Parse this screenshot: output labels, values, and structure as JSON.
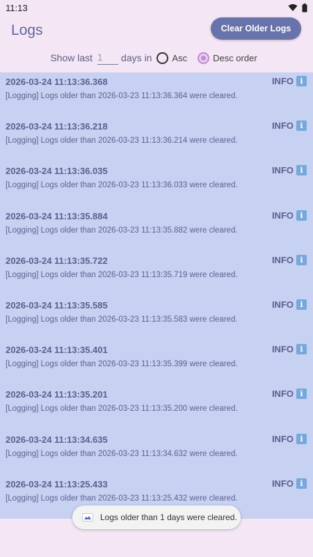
{
  "status_bar": {
    "time": "11:13",
    "icons": [
      "wifi-icon",
      "battery-icon"
    ]
  },
  "header": {
    "title": "Logs",
    "clear_button_label": "Clear Older Logs"
  },
  "filter": {
    "show_last_label": "Show last",
    "days_value": "1",
    "days_in_label": "days in",
    "asc_label": "Asc",
    "desc_label": "Desc order",
    "selected_order": "desc"
  },
  "logs": [
    {
      "time": "2026-03-24 11:13:36.368",
      "level": "INFO",
      "message": "[Logging] Logs older than 2026-03-23 11:13:36.364 were cleared."
    },
    {
      "time": "2026-03-24 11:13:36.218",
      "level": "INFO",
      "message": "[Logging] Logs older than 2026-03-23 11:13:36.214 were cleared."
    },
    {
      "time": "2026-03-24 11:13:36.035",
      "level": "INFO",
      "message": "[Logging] Logs older than 2026-03-23 11:13:36.033 were cleared."
    },
    {
      "time": "2026-03-24 11:13:35.884",
      "level": "INFO",
      "message": "[Logging] Logs older than 2026-03-23 11:13:35.882 were cleared."
    },
    {
      "time": "2026-03-24 11:13:35.722",
      "level": "INFO",
      "message": "[Logging] Logs older than 2026-03-23 11:13:35.719 were cleared."
    },
    {
      "time": "2026-03-24 11:13:35.585",
      "level": "INFO",
      "message": "[Logging] Logs older than 2026-03-23 11:13:35.583 were cleared."
    },
    {
      "time": "2026-03-24 11:13:35.401",
      "level": "INFO",
      "message": "[Logging] Logs older than 2026-03-23 11:13:35.399 were cleared."
    },
    {
      "time": "2026-03-24 11:13:35.201",
      "level": "INFO",
      "message": "[Logging] Logs older than 2026-03-23 11:13:35.200 were cleared."
    },
    {
      "time": "2026-03-24 11:13:34.635",
      "level": "INFO",
      "message": "[Logging] Logs older than 2026-03-23 11:13:34.632 were cleared."
    },
    {
      "time": "2026-03-24 11:13:25.433",
      "level": "INFO",
      "message": "[Logging] Logs older than 2026-03-23 11:13:25.432 were cleared."
    }
  ],
  "info_icon_glyph": "i",
  "toast": {
    "message": "Logs older than 1 days were cleared."
  },
  "colors": {
    "accent": "#6872ab",
    "list_background": "#c7d1f2",
    "page_background": "#f4e6f4",
    "radio_selected": "#c28bd6"
  }
}
